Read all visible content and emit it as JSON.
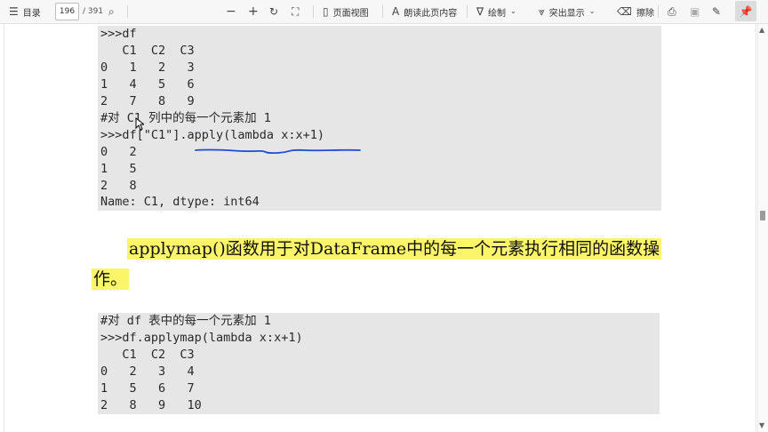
{
  "toolbar": {
    "toc_label": "目录",
    "page_current": "196",
    "page_total": "/ 391",
    "page_view_label": "页面视图",
    "read_aloud_label": "朗读此页内容",
    "draw_label": "绘制",
    "highlight_label": "突出显示",
    "erase_label": "擦除"
  },
  "code_block_1": {
    "lines": [
      ">>>df",
      "   C1  C2  C3",
      "0   1   2   3",
      "1   4   5   6",
      "2   7   8   9",
      "#对 C1 列中的每一个元素加 1",
      ">>>df[\"C1\"].apply(lambda x:x+1)",
      "0   2",
      "1   5",
      "2   8",
      "Name: C1, dtype: int64"
    ]
  },
  "paragraph": {
    "line1": "applymap()函数用于对DataFrame中的每一个元素执行相同的函数操",
    "line2": "作。"
  },
  "code_block_2": {
    "lines": [
      "#对 df 表中的每一个元素加 1",
      ">>>df.applymap(lambda x:x+1)",
      "   C1  C2  C3",
      "0   2   3   4",
      "1   5   6   7",
      "2   8   9   10"
    ]
  },
  "annotations": {
    "ink_color": "#1f49d8",
    "highlight_color": "#fbf56a"
  }
}
